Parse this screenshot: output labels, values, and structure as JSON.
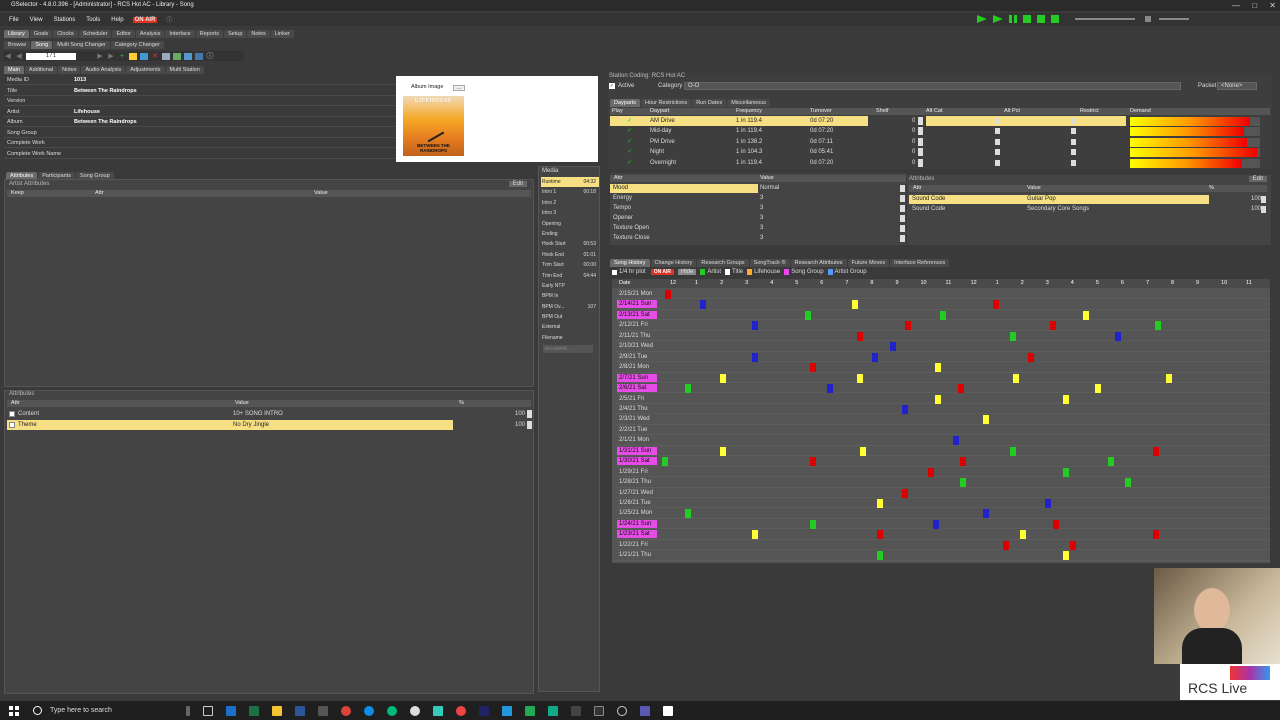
{
  "window": {
    "title": "GSelector - 4.8.0.396 - [Administrator] - RCS Hot AC - Library - Song"
  },
  "menu": {
    "items": [
      "File",
      "View",
      "Stations",
      "Tools",
      "Help"
    ],
    "onair": "ON AIR"
  },
  "app_tabs": [
    "Library",
    "Goals",
    "Clocks",
    "Scheduler",
    "Editor",
    "Analysis",
    "Interface",
    "Reports",
    "Setup",
    "Notes",
    "Linker"
  ],
  "sub_tabs": [
    "Browse",
    "Song",
    "Multi Song Changer",
    "Category Changer"
  ],
  "pager": {
    "value": "1 / 1"
  },
  "song_tabs": [
    "Main",
    "Additional",
    "Notes",
    "Audio Analysis",
    "Adjustments",
    "Multi Station"
  ],
  "fields": [
    {
      "label": "Media ID",
      "value": "1013"
    },
    {
      "label": "Title",
      "value": "Between The Raindrops"
    },
    {
      "label": "Version",
      "value": ""
    },
    {
      "label": "Artist",
      "value": "Lifehouse"
    },
    {
      "label": "Album",
      "value": "Between The Raindrops"
    },
    {
      "label": "Song Group",
      "value": ""
    },
    {
      "label": "Complete Work",
      "value": ""
    },
    {
      "label": "Complete Work Name",
      "value": ""
    }
  ],
  "album": {
    "label": "Album Image",
    "art_text": "BETWEEN THE RAINDROPS",
    "art_brand": "LIFEHOUSE",
    "btn": "..."
  },
  "attr_tabs": [
    "Attributes",
    "Participants",
    "Song Group"
  ],
  "artist_attributes": {
    "title": "Artist Attributes",
    "edit": "Edit",
    "cols": [
      "Keep",
      "Attr",
      "Value"
    ]
  },
  "attributes": {
    "title": "Attributes",
    "cols": [
      "Attr",
      "Value",
      "%"
    ],
    "rows": [
      {
        "attr": "Content",
        "value": "10+ SONG INTRO",
        "pct": "100"
      },
      {
        "attr": "Theme",
        "value": "No Dry Jingle",
        "pct": "100"
      }
    ]
  },
  "media": {
    "title": "Media",
    "rows": [
      {
        "label": "Runtime",
        "value": "04:32"
      },
      {
        "label": "Intro 1",
        "value": "00:18"
      },
      {
        "label": "Intro 2",
        "value": ""
      },
      {
        "label": "Intro 3",
        "value": ""
      },
      {
        "label": "Opening",
        "value": ""
      },
      {
        "label": "Ending",
        "value": ""
      },
      {
        "label": "Hook Start",
        "value": "00:53"
      },
      {
        "label": "Hook End",
        "value": "01:01"
      },
      {
        "label": "Trim Start",
        "value": "00:00"
      },
      {
        "label": "Trim End",
        "value": "04:44"
      },
      {
        "label": "Early NTP",
        "value": ""
      },
      {
        "label": "BPM In",
        "value": ""
      },
      {
        "label": "BPM Ov...",
        "value": "107"
      },
      {
        "label": "BPM Out",
        "value": ""
      },
      {
        "label": "External",
        "value": ""
      },
      {
        "label": "Filename",
        "value": ""
      }
    ],
    "filename_value": "\\RCSMP\\R..."
  },
  "station_coding": {
    "title": "Station Coding: RCS Hot AC",
    "active": "Active",
    "category_label": "Category",
    "category_value": "O-O",
    "packet_label": "Packet",
    "packet_value": "<None>"
  },
  "daypart_tabs": [
    "Dayparts",
    "Hour Restrictions",
    "Run Dates",
    "Miscellaneous"
  ],
  "daypart_cols": [
    "Play",
    "Daypart",
    "Frequency",
    "Turnover",
    "Shelf",
    "Alt Cat",
    "Alt Pct",
    "Restrict",
    "Demand"
  ],
  "dayparts": [
    {
      "name": "AM Drive",
      "freq": "1 in  119.4",
      "turn": "0d 07:20",
      "shelf": "0",
      "demand": 0.92
    },
    {
      "name": "Mid-day",
      "freq": "1 in  119.4",
      "turn": "0d 07:20",
      "shelf": "0",
      "demand": 0.88
    },
    {
      "name": "PM Drive",
      "freq": "1 in  136.2",
      "turn": "0d 07:11",
      "shelf": "0",
      "demand": 0.9
    },
    {
      "name": "Night",
      "freq": "1 in  104.3",
      "turn": "0d 05:41",
      "shelf": "0",
      "demand": 0.98
    },
    {
      "name": "Overnight",
      "freq": "1 in  119.4",
      "turn": "0d 07:20",
      "shelf": "0",
      "demand": 0.86
    }
  ],
  "song_attrs": {
    "cols": [
      "Attr",
      "Value"
    ],
    "rows": [
      {
        "attr": "Mood",
        "value": "Normal"
      },
      {
        "attr": "Energy",
        "value": "3"
      },
      {
        "attr": "Tempo",
        "value": "3"
      },
      {
        "attr": "Opener",
        "value": "3"
      },
      {
        "attr": "Texture Open",
        "value": "3"
      },
      {
        "attr": "Texture Close",
        "value": "3"
      }
    ]
  },
  "code_attrs": {
    "title": "Attributes",
    "edit": "Edit",
    "cols": [
      "Attr",
      "Value",
      "%"
    ],
    "rows": [
      {
        "attr": "Sound Code",
        "value": "Guitar Pop",
        "pct": "100"
      },
      {
        "attr": "Sound Code",
        "value": "Secondary Core Songs",
        "pct": "100"
      }
    ]
  },
  "history_tabs": [
    "Song History",
    "Change History",
    "Research Groups",
    "SongTrack ®",
    "Research Attributes",
    "Future Moves",
    "Interface References"
  ],
  "history_opts": {
    "per_hr": "1/4 hr plot",
    "onair": "ON AIR",
    "hide": "Hide",
    "artist": "Artist",
    "title": "Title",
    "lifehouse": "Lifehouse",
    "song_group": "Song Group",
    "artist_group": "Artist Group"
  },
  "history": {
    "date_col": "Date",
    "hours": [
      "12",
      "1",
      "2",
      "3",
      "4",
      "5",
      "6",
      "7",
      "8",
      "9",
      "10",
      "11",
      "12",
      "1",
      "2",
      "3",
      "4",
      "5",
      "6",
      "7",
      "8",
      "9",
      "10",
      "11"
    ],
    "dates": [
      "2/15/21 Mon",
      "2/14/21 Sun",
      "2/13/21 Sat",
      "2/12/21 Fri",
      "2/11/21 Thu",
      "2/10/21 Wed",
      "2/9/21 Tue",
      "2/8/21 Mon",
      "2/7/21 Sun",
      "2/6/21 Sat",
      "2/5/21 Fri",
      "2/4/21 Thu",
      "2/3/21 Wed",
      "2/2/21 Tue",
      "2/1/21 Mon",
      "1/31/21 Sun",
      "1/30/21 Sat",
      "1/29/21 Fri",
      "1/28/21 Thu",
      "1/27/21 Wed",
      "1/26/21 Tue",
      "1/25/21 Mon",
      "1/24/21 Sun",
      "1/23/21 Sat",
      "1/22/21 Fri",
      "1/21/21 Thu"
    ],
    "weekend": [
      1,
      2,
      8,
      9,
      15,
      16,
      22,
      23
    ],
    "marks": [
      [
        0,
        0.1,
        "#d00"
      ],
      [
        1,
        1.5,
        "#22c"
      ],
      [
        1,
        7.6,
        "#ff3"
      ],
      [
        1,
        13.2,
        "#d00"
      ],
      [
        2,
        5.7,
        "#2c2"
      ],
      [
        2,
        11.1,
        "#2c2"
      ],
      [
        2,
        16.8,
        "#ff3"
      ],
      [
        3,
        3.6,
        "#22c"
      ],
      [
        3,
        9.7,
        "#d00"
      ],
      [
        3,
        15.5,
        "#d00"
      ],
      [
        3,
        19.7,
        "#2c2"
      ],
      [
        4,
        7.8,
        "#d00"
      ],
      [
        4,
        13.9,
        "#2c2"
      ],
      [
        4,
        18.1,
        "#22c"
      ],
      [
        5,
        9.1,
        "#22c"
      ],
      [
        6,
        3.6,
        "#22c"
      ],
      [
        6,
        8.4,
        "#22c"
      ],
      [
        6,
        14.6,
        "#d00"
      ],
      [
        7,
        5.9,
        "#d00"
      ],
      [
        7,
        10.9,
        "#ff3"
      ],
      [
        8,
        2.3,
        "#ff3"
      ],
      [
        8,
        7.8,
        "#ff3"
      ],
      [
        8,
        14,
        "#ff3"
      ],
      [
        8,
        20.1,
        "#ff3"
      ],
      [
        9,
        0.9,
        "#2c2"
      ],
      [
        9,
        6.6,
        "#22c"
      ],
      [
        9,
        11.8,
        "#d00"
      ],
      [
        9,
        17.3,
        "#ff3"
      ],
      [
        10,
        10.9,
        "#ff3"
      ],
      [
        10,
        16,
        "#ff3"
      ],
      [
        11,
        9.6,
        "#22c"
      ],
      [
        12,
        12.8,
        "#ff3"
      ],
      [
        14,
        11.6,
        "#22c"
      ],
      [
        15,
        2.3,
        "#ff3"
      ],
      [
        15,
        7.9,
        "#ff3"
      ],
      [
        15,
        13.9,
        "#2c2"
      ],
      [
        15,
        19.6,
        "#d00"
      ],
      [
        16,
        0,
        "#2c2"
      ],
      [
        16,
        5.9,
        "#d00"
      ],
      [
        16,
        11.9,
        "#d00"
      ],
      [
        16,
        17.8,
        "#2c2"
      ],
      [
        17,
        10.6,
        "#d00"
      ],
      [
        17,
        16,
        "#2c2"
      ],
      [
        18,
        11.9,
        "#2c2"
      ],
      [
        18,
        18.5,
        "#2c2"
      ],
      [
        19,
        9.6,
        "#d00"
      ],
      [
        20,
        8.6,
        "#ff3"
      ],
      [
        20,
        15.3,
        "#22c"
      ],
      [
        21,
        0.9,
        "#2c2"
      ],
      [
        21,
        12.8,
        "#22c"
      ],
      [
        22,
        5.9,
        "#2c2"
      ],
      [
        22,
        10.8,
        "#22c"
      ],
      [
        22,
        15.6,
        "#d00"
      ],
      [
        23,
        3.6,
        "#ff3"
      ],
      [
        23,
        8.6,
        "#d00"
      ],
      [
        23,
        14.3,
        "#ff3"
      ],
      [
        23,
        19.6,
        "#d00"
      ],
      [
        24,
        13.6,
        "#d00"
      ],
      [
        24,
        16.3,
        "#d00"
      ],
      [
        25,
        8.6,
        "#2c2"
      ],
      [
        25,
        16,
        "#ff3"
      ]
    ]
  },
  "taskbar": {
    "search_placeholder": "Type here to search"
  },
  "watermark": "RCS Live"
}
